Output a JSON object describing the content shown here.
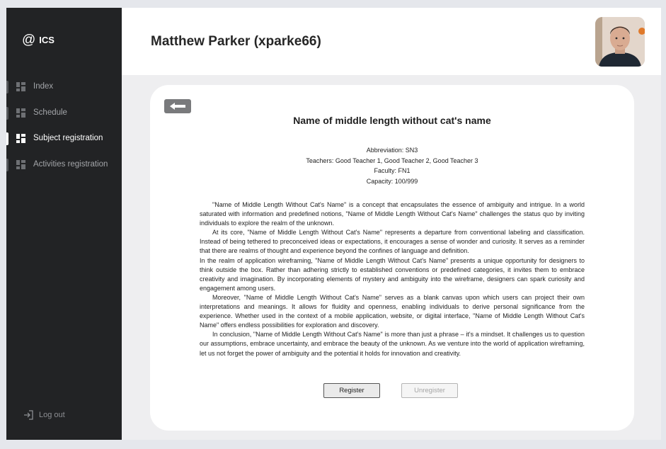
{
  "app": {
    "logo_text": "ICS",
    "logo_symbol": "@"
  },
  "sidebar": {
    "items": [
      {
        "label": "Index",
        "icon": "dashboard-icon",
        "active": false
      },
      {
        "label": "Schedule",
        "icon": "dashboard-icon",
        "active": false
      },
      {
        "label": "Subject registration",
        "icon": "dashboard-icon",
        "active": true
      },
      {
        "label": "Activities registration",
        "icon": "dashboard-icon",
        "active": false
      }
    ],
    "logout_label": "Log out",
    "logout_icon": "logout-icon"
  },
  "header": {
    "user_name": "Matthew Parker (xparke66)",
    "avatar_icon": "user-avatar"
  },
  "subject": {
    "title": "Name of middle length without cat's name",
    "abbreviation": "Abbreviation: SN3",
    "teachers": "Teachers: Good Teacher 1, Good Teacher 2, Good Teacher 3",
    "faculty": "Faculty: FN1",
    "capacity": "Capacity: 100/999",
    "paragraphs": [
      "\"Name of Middle Length Without Cat's Name\" is a concept that encapsulates the essence of ambiguity and intrigue. In a world saturated with information and predefined notions, \"Name of Middle Length Without Cat's Name\" challenges the status quo by inviting individuals to explore the realm of the unknown.",
      "At its core, \"Name of Middle Length Without Cat's Name\" represents a departure from conventional labeling and classification. Instead of being tethered to preconceived ideas or expectations, it encourages a sense of wonder and curiosity. It serves as a reminder that there are realms of thought and experience beyond the confines of language and definition.",
      "In the realm of application wireframing, \"Name of Middle Length Without Cat's Name\" presents a unique opportunity for designers to think outside the box. Rather than adhering strictly to established conventions or predefined categories, it invites them to embrace creativity and imagination. By incorporating elements of mystery and ambiguity into the wireframe, designers can spark curiosity and engagement among users.",
      "Moreover, \"Name of Middle Length Without Cat's Name\" serves as a blank canvas upon which users can project their own interpretations and meanings. It allows for fluidity and openness, enabling individuals to derive personal significance from the experience. Whether used in the context of a mobile application, website, or digital interface, \"Name of Middle Length Without Cat's Name\" offers endless possibilities for exploration and discovery.",
      "In conclusion, \"Name of Middle Length Without Cat's Name\" is more than just a phrase – it's a mindset. It challenges us to question our assumptions, embrace uncertainty, and embrace the beauty of the unknown. As we venture into the world of application wireframing, let us not forget the power of ambiguity and the potential it holds for innovation and creativity."
    ]
  },
  "actions": {
    "back_icon": "arrow-left-icon",
    "register_label": "Register",
    "unregister_label": "Unregister"
  },
  "colors": {
    "sidebar_bg": "#222325",
    "page_bg": "#eeeef0",
    "back_button_bg": "#797a7c"
  }
}
